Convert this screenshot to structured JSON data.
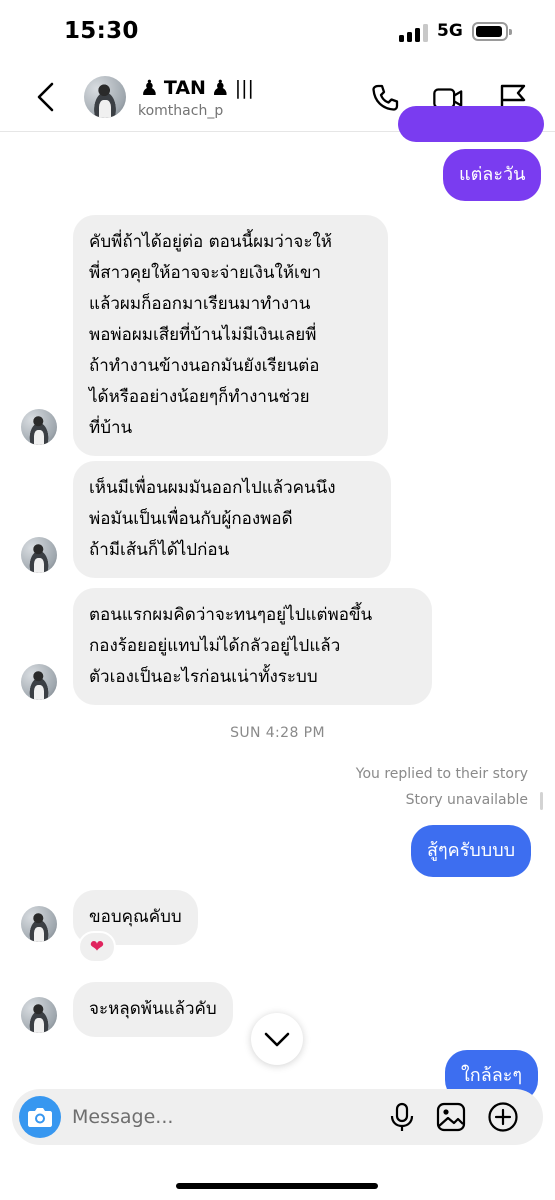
{
  "status": {
    "time": "15:30",
    "network": "5G"
  },
  "header": {
    "display_name": "TAN",
    "decor_left": "♟",
    "decor_right": "♟",
    "decor_bars": "|||",
    "username": "komthach_p"
  },
  "messages": [
    {
      "from": "me",
      "text": "แต่ละวัน"
    },
    {
      "from": "them",
      "lines": [
        "คับพี่ถ้าได้อยู่ต่อ ตอนนี้ผมว่าจะให้",
        "พี่สาวคุยให้อาจจะจ่ายเงินให้เขา",
        "แล้วผมก็ออกมาเรียนมาทำงาน",
        "พอพ่อผมเสียที่บ้านไม่มีเงินเลยพี่",
        "ถ้าทำงานข้างนอกมันยังเรียนต่อ",
        "ได้หรืออย่างน้อยๆก็ทำงานช่วย",
        "ที่บ้าน"
      ]
    },
    {
      "from": "them",
      "lines": [
        "เห็นมีเพื่อนผมมันออกไปแล้วคนนึง",
        "พ่อมันเป็นเพื่อนกับผู้กองพอดี",
        "ถ้ามีเส้นก็ได้ไปก่อน"
      ]
    },
    {
      "from": "them",
      "lines": [
        "ตอนแรกผมคิดว่าจะทนๆอยู่ไปแต่พอขึ้น",
        "กองร้อยอยู่แทบไม่ได้กลัวอยู่ไปแล้ว",
        "ตัวเองเป็นอะไรก่อนเน่าทั้งระบบ"
      ]
    },
    {
      "from": "me",
      "text": "สู้ๆครับบบบ"
    },
    {
      "from": "them",
      "text": "ขอบคุณคับบ",
      "reaction": "❤"
    },
    {
      "from": "them",
      "text": "จะหลุดพ้นแล้วคับ"
    },
    {
      "from": "me",
      "text": "ใกล้ละๆ"
    }
  ],
  "timestamp": "SUN 4:28 PM",
  "story_reply": {
    "label": "You replied to their story",
    "status": "Story unavailable"
  },
  "composer": {
    "placeholder": "Message..."
  },
  "colors": {
    "bubble_purple": "#7a3cf0",
    "bubble_blue": "#3d6ef0",
    "incoming_bubble": "#efefef",
    "camera_button": "#3797f0",
    "heart": "#e0245e"
  },
  "icons": [
    "back-icon",
    "phone-icon",
    "video-icon",
    "flag-icon",
    "camera-icon",
    "mic-icon",
    "gallery-icon",
    "plus-icon",
    "chevron-down-icon"
  ]
}
